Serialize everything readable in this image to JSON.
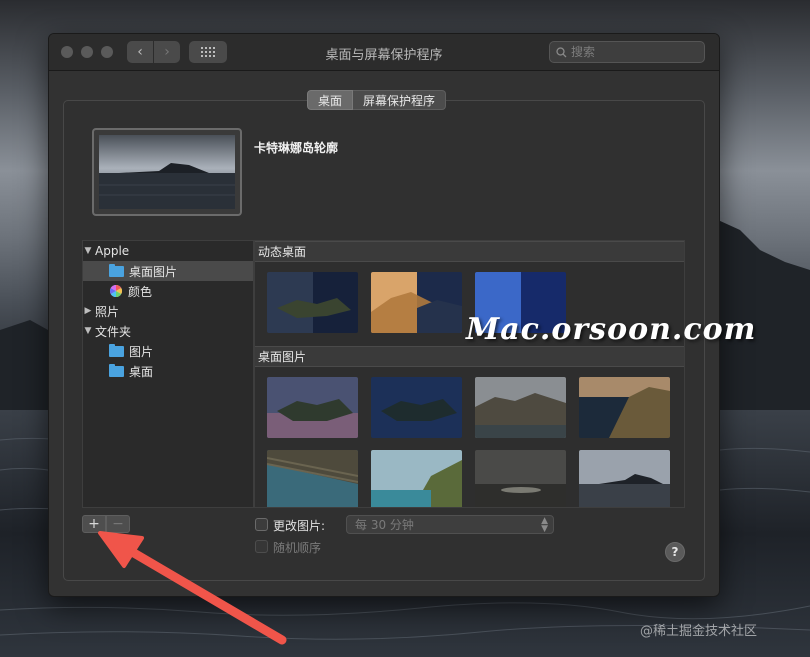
{
  "window": {
    "title": "桌面与屏幕保护程序",
    "search_placeholder": "搜索"
  },
  "tabs": [
    {
      "label": "桌面",
      "active": true
    },
    {
      "label": "屏幕保护程序",
      "active": false
    }
  ],
  "preview": {
    "name": "卡特琳娜岛轮廓"
  },
  "sidebar": {
    "items": [
      {
        "label": "Apple",
        "type": "group",
        "expanded": true
      },
      {
        "label": "桌面图片",
        "type": "folder",
        "selected": true
      },
      {
        "label": "颜色",
        "type": "color"
      },
      {
        "label": "照片",
        "type": "group",
        "expanded": false
      },
      {
        "label": "文件夹",
        "type": "group",
        "expanded": true
      },
      {
        "label": "图片",
        "type": "folder"
      },
      {
        "label": "桌面",
        "type": "folder"
      }
    ]
  },
  "grid": {
    "sections": [
      {
        "title": "动态桌面"
      },
      {
        "title": "桌面图片"
      }
    ]
  },
  "bottom": {
    "add_label": "+",
    "remove_label": "−",
    "change_picture_label": "更改图片:",
    "interval_value": "每 30 分钟",
    "random_order_label": "随机顺序",
    "help_label": "?"
  },
  "overlay": {
    "watermark": "Mac.orsoon.com",
    "credit": "@稀土掘金技术社区"
  }
}
